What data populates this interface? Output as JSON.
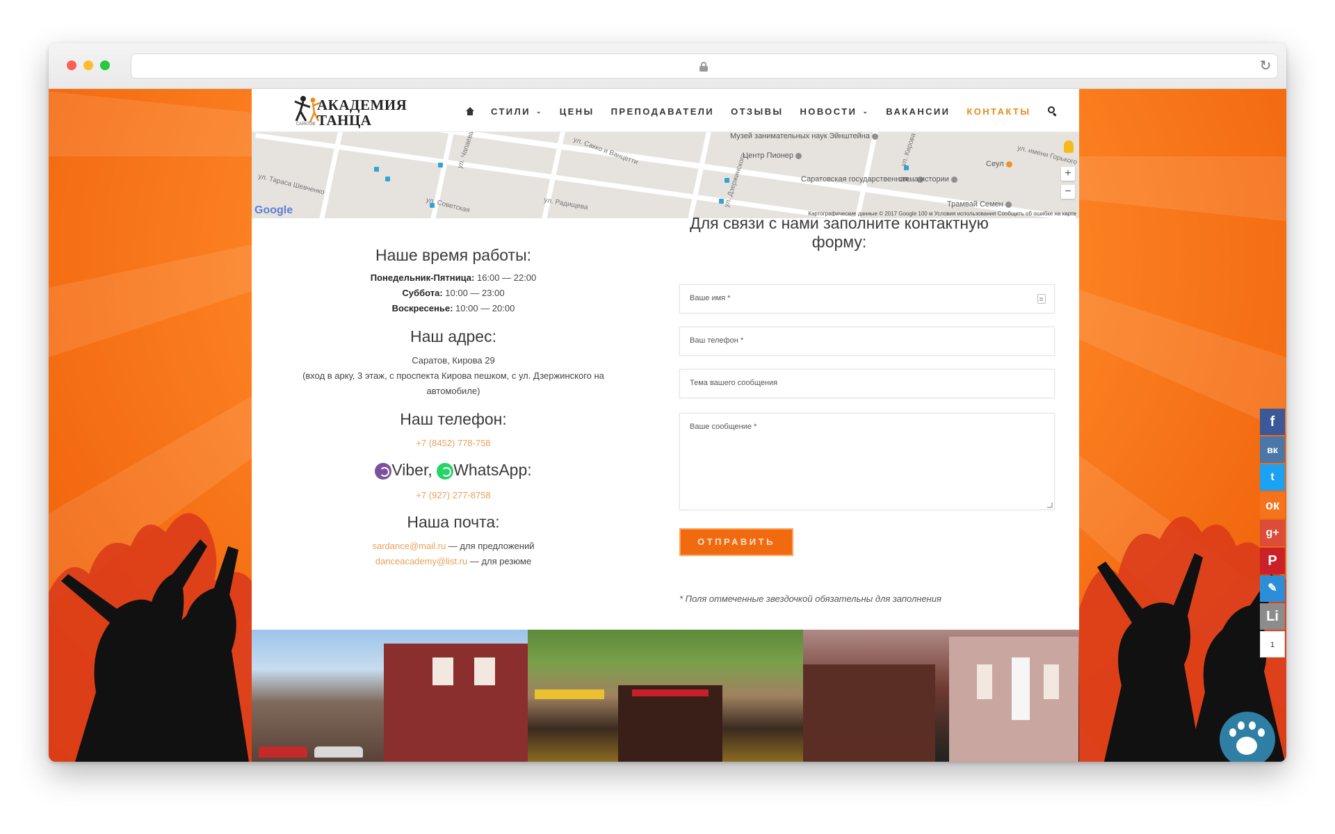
{
  "browser": {
    "address": ""
  },
  "logo": {
    "line1": "АКАДЕМИЯ",
    "line2": "ТАНЦА",
    "city": "САРАТОВ"
  },
  "nav": {
    "items": [
      "СТИЛИ",
      "ЦЕНЫ",
      "ПРЕПОДАВАТЕЛИ",
      "ОТЗЫВЫ",
      "НОВОСТИ",
      "ВАКАНСИИ",
      "КОНТАКТЫ"
    ],
    "active": "КОНТАКТЫ",
    "dropdown_glyph": "⌄"
  },
  "map": {
    "streets": [
      "ул. Тараса Шевченко",
      "ул. Советская",
      "ул. Сакко и Ванцетти",
      "ул. Чапаева",
      "ул. Радищева",
      "ул. имени Горького",
      "ул. Дзержинского",
      "ул. Кирова"
    ],
    "pois": [
      "Музей занимательных наук Эйнштейна",
      "Центр Пионер",
      "Саратовская государственная...",
      "стена истории",
      "Сеул",
      "Трамвай Семен"
    ],
    "attribution": "Картографические данные © 2017 Google   100 м   Условия использования   Сообщить об ошибке на карте",
    "logo": "Google",
    "zoom_in": "+",
    "zoom_out": "−"
  },
  "hours": {
    "title": "Наше время работы:",
    "rows": [
      {
        "label": "Понедельник-Пятница:",
        "value": "16:00 — 22:00"
      },
      {
        "label": "Суббота:",
        "value": "10:00 — 23:00"
      },
      {
        "label": "Воскресенье:",
        "value": "10:00 — 20:00"
      }
    ]
  },
  "address": {
    "title": "Наш адрес:",
    "line1": "Саратов, Кирова 29",
    "line2": "(вход в арку, 3 этаж, с проспекта Кирова пешком, с ул. Дзержинского на автомобиле)"
  },
  "phone": {
    "title": "Наш телефон:",
    "number": "+7 (8452) 778-758"
  },
  "messengers": {
    "viber": "Viber,",
    "whatsapp": "WhatsApp:",
    "number": "+7 (927) 277-8758"
  },
  "mail": {
    "title": "Наша почта:",
    "rows": [
      {
        "email": "sardance@mail.ru",
        "note": " — для предложений"
      },
      {
        "email": "danceacademy@list.ru",
        "note": " — для резюме"
      }
    ]
  },
  "form": {
    "title": "Для связи с нами заполните контактную форму:",
    "name_ph": "Ваше имя *",
    "phone_ph": "Ваш телефон *",
    "subject_ph": "Тема вашего сообщения",
    "message_ph": "Ваше сообщение *",
    "submit": "ОТПРАВИТЬ",
    "note": "* Поля отмеченные звездочкой обязательны для заполнения"
  },
  "social": {
    "icons": [
      "facebook-icon",
      "vk-icon",
      "twitter-icon",
      "odnoklassniki-icon",
      "google-plus-icon",
      "pinterest-icon",
      "livejournal-icon",
      "liveinternet-icon"
    ],
    "glyphs": [
      "f",
      "вк",
      "t",
      "ок",
      "g+",
      "P",
      "✎",
      "Li"
    ],
    "count": "1"
  },
  "colors": {
    "accent": "#e98a18",
    "button": "#f06a10",
    "link": "#e9a05a",
    "background": "#f36a10"
  }
}
